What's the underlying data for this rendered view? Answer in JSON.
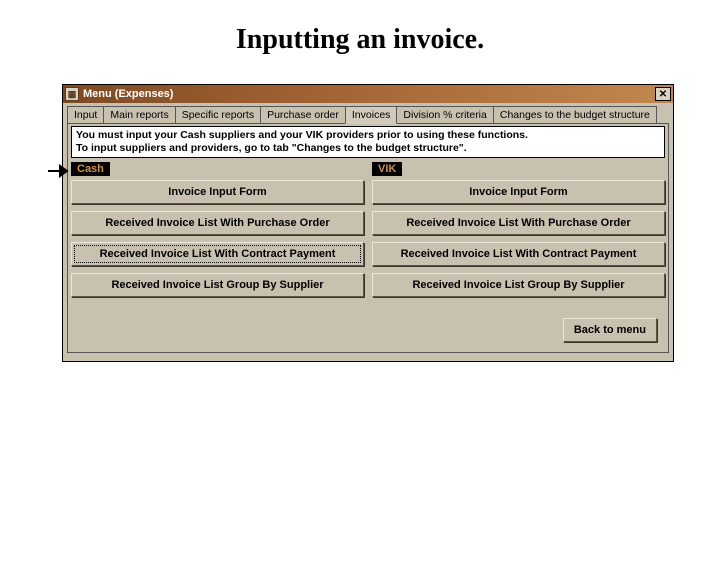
{
  "page_title": "Inputting an invoice.",
  "window": {
    "title": "Menu (Expenses)",
    "close_glyph": "✕"
  },
  "tabs": [
    "Input",
    "Main reports",
    "Specific reports",
    "Purchase order",
    "Invoices",
    "Division % criteria",
    "Changes to the budget structure"
  ],
  "active_tab_index": 4,
  "notice": {
    "line1": "You must input your Cash suppliers and your VIK providers prior to using these functions.",
    "line2": "To input suppliers and providers, go to tab \"Changes to the budget structure\"."
  },
  "columns": {
    "cash": {
      "header": "Cash",
      "buttons": [
        "Invoice Input Form",
        "Received Invoice List  With  Purchase Order",
        "Received Invoice List With Contract Payment",
        "Received Invoice List Group By Supplier"
      ]
    },
    "vik": {
      "header": "VIK",
      "buttons": [
        "Invoice Input Form",
        "Received Invoice List  With  Purchase Order",
        "Received Invoice List With Contract Payment",
        "Received Invoice List Group By Supplier"
      ]
    }
  },
  "footer": {
    "back_label": "Back to menu"
  }
}
